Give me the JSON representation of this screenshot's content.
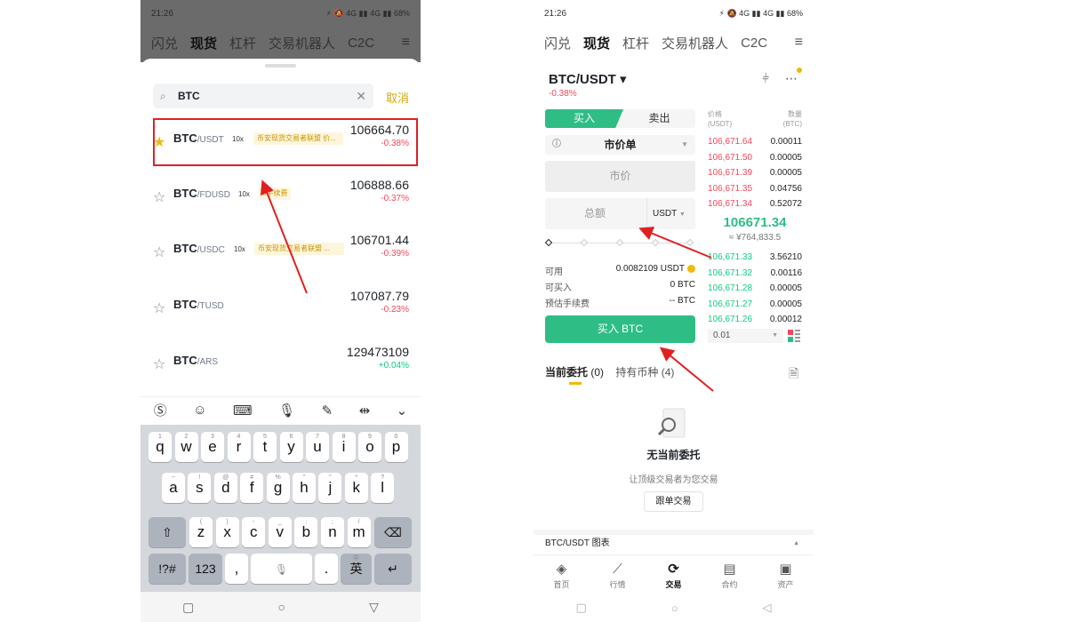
{
  "status": {
    "time": "21:26",
    "right": "⚡ 🔕 4G ▮▮ 4G ▮▮ 68%"
  },
  "nav": {
    "tabs": [
      "闪兑",
      "现货",
      "杠杆",
      "交易机器人",
      "C2C"
    ],
    "active": "现货"
  },
  "left": {
    "search": {
      "value": "BTC",
      "cancel": "取消"
    },
    "pairs": [
      {
        "base": "BTC",
        "quote": "/USDT",
        "lev": "10x",
        "tag": "币安现货交易者联盟 价...",
        "price": "106664.70",
        "change": "-0.38%",
        "fav": true
      },
      {
        "base": "BTC",
        "quote": "/FDUSD",
        "lev": "10x",
        "tag": "0手续费",
        "price": "106888.66",
        "change": "-0.37%",
        "fav": false
      },
      {
        "base": "BTC",
        "quote": "/USDC",
        "lev": "10x",
        "tag": "币安现货交易者联盟 ...",
        "price": "106701.44",
        "change": "-0.39%",
        "fav": false
      },
      {
        "base": "BTC",
        "quote": "/TUSD",
        "lev": "",
        "tag": "",
        "price": "107087.79",
        "change": "-0.23%",
        "fav": false
      },
      {
        "base": "BTC",
        "quote": "/ARS",
        "lev": "",
        "tag": "",
        "price": "129473109",
        "change": "+0.04%",
        "fav": false
      }
    ],
    "keyboard": {
      "row1": [
        [
          "q",
          "1"
        ],
        [
          "w",
          "2"
        ],
        [
          "e",
          "3"
        ],
        [
          "r",
          "4"
        ],
        [
          "t",
          "5"
        ],
        [
          "y",
          "6"
        ],
        [
          "u",
          "7"
        ],
        [
          "i",
          "8"
        ],
        [
          "o",
          "9"
        ],
        [
          "p",
          "0"
        ]
      ],
      "row2": [
        [
          "a",
          "~"
        ],
        [
          "s",
          "!"
        ],
        [
          "d",
          "@"
        ],
        [
          "f",
          "#"
        ],
        [
          "g",
          "%"
        ],
        [
          "h",
          "\""
        ],
        [
          "j",
          "\""
        ],
        [
          "k",
          "*"
        ],
        [
          "l",
          "?"
        ]
      ],
      "row3": [
        [
          "z",
          "("
        ],
        [
          "x",
          ")"
        ],
        [
          "c",
          "-"
        ],
        [
          "v",
          "_"
        ],
        [
          "b",
          ":"
        ],
        [
          "n",
          ";"
        ],
        [
          "m",
          "/"
        ]
      ],
      "sym": "!?#",
      "num": "123",
      "comma": ",",
      "period": ".",
      "lang": "英",
      "lang_sub": "中"
    }
  },
  "right": {
    "pair": "BTC/USDT ▾",
    "change": "-0.38%",
    "buy_tab": "买入",
    "sell_tab": "卖出",
    "order_type": "市价单",
    "market_price": "市价",
    "total_label": "总额",
    "total_currency": "USDT",
    "available_label": "可用",
    "available_value": "0.0082109 USDT",
    "can_buy_label": "可买入",
    "can_buy_value": "0 BTC",
    "fee_label": "预估手续费",
    "fee_value": "-- BTC",
    "buy_button": "买入 BTC",
    "ob_price_head": "价格\n(USDT)",
    "ob_qty_head": "数量\n(BTC)",
    "asks": [
      {
        "p": "106,671.64",
        "q": "0.00011"
      },
      {
        "p": "106,671.50",
        "q": "0.00005"
      },
      {
        "p": "106,671.39",
        "q": "0.00005"
      },
      {
        "p": "106,671.35",
        "q": "0.04756"
      },
      {
        "p": "106,671.34",
        "q": "0.52072"
      }
    ],
    "mid_price": "106671.34",
    "mid_cny": "≈ ¥764,833.5",
    "bids": [
      {
        "p": "106,671.33",
        "q": "3.56210"
      },
      {
        "p": "106,671.32",
        "q": "0.00116"
      },
      {
        "p": "106,671.28",
        "q": "0.00005"
      },
      {
        "p": "106,671.27",
        "q": "0.00005"
      },
      {
        "p": "106,671.26",
        "q": "0.00012"
      }
    ],
    "precision": "0.01",
    "open_orders_tab": "当前委托",
    "open_orders_count": "(0)",
    "holdings_tab": "持有币种",
    "holdings_count": "(4)",
    "empty_title": "无当前委托",
    "empty_sub": "让顶级交易者为您交易",
    "copy_trade": "跟单交易",
    "chart_label": "BTC/USDT 图表",
    "bottom_nav": [
      "首页",
      "行情",
      "交易",
      "合约",
      "资产"
    ]
  },
  "colors": {
    "up": "#2ebd85",
    "down": "#f6465d",
    "accent": "#f0b90b",
    "annotation": "#e02020"
  }
}
